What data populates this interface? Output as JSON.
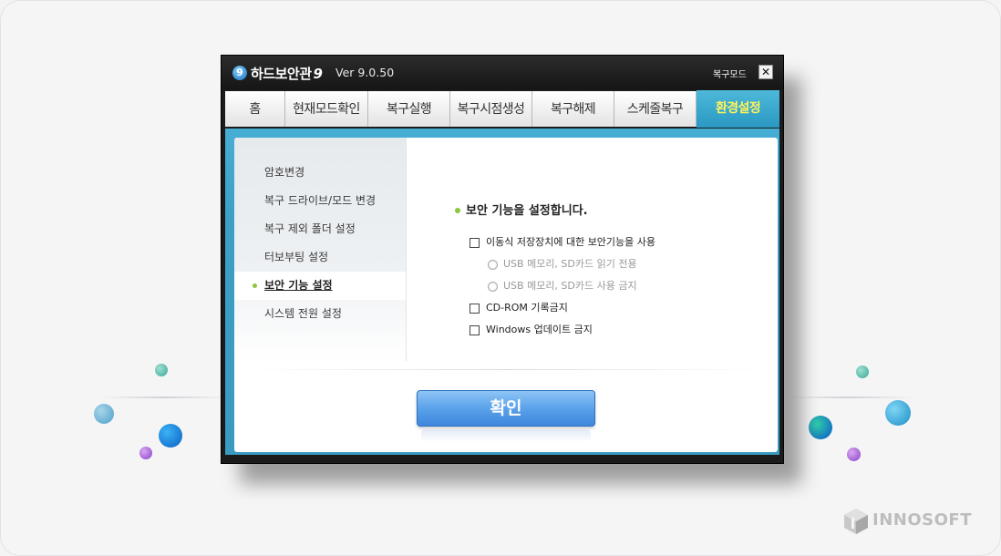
{
  "window": {
    "app_title": "하드보안관",
    "logo_glyph": "9",
    "title_number": "9",
    "version": "Ver 9.0.50",
    "recovery_mode_label": "복구모드",
    "close_label": "✕"
  },
  "tabs": [
    {
      "label": "홈",
      "active": false
    },
    {
      "label": "현재모드확인",
      "active": false
    },
    {
      "label": "복구실행",
      "active": false
    },
    {
      "label": "복구시점생성",
      "active": false
    },
    {
      "label": "복구해제",
      "active": false
    },
    {
      "label": "스케줄복구",
      "active": false
    },
    {
      "label": "환경설정",
      "active": true
    }
  ],
  "sidebar": {
    "items": [
      {
        "label": "암호변경",
        "active": false
      },
      {
        "label": "복구 드라이브/모드 변경",
        "active": false
      },
      {
        "label": "복구 제외 폴더 설정",
        "active": false
      },
      {
        "label": "터보부팅 설정",
        "active": false
      },
      {
        "label": "보안 기능 설정",
        "active": true
      },
      {
        "label": "시스템 전원 설정",
        "active": false
      }
    ]
  },
  "security": {
    "title": "보안 기능을 설정합니다.",
    "options": [
      {
        "type": "checkbox",
        "label": "이동식 저장장치에 대한 보안기능을 사용",
        "checked": false,
        "enabled": true
      },
      {
        "type": "radio",
        "label": "USB 메모리, SD카드 읽기 전용",
        "checked": false,
        "enabled": false
      },
      {
        "type": "radio",
        "label": "USB 메모리, SD카드 사용 금지",
        "checked": false,
        "enabled": false
      },
      {
        "type": "checkbox",
        "label": "CD-ROM 기록금지",
        "checked": false,
        "enabled": true
      },
      {
        "type": "checkbox",
        "label": "Windows 업데이트 금지",
        "checked": false,
        "enabled": true
      }
    ]
  },
  "confirm_label": "확인",
  "brand": {
    "name": "INNOSOFT"
  },
  "colors": {
    "accent_blue": "#3b9ac2",
    "active_tab_text": "#fff35a",
    "bullet_green": "#8dc63f",
    "button_blue": "#5aa2ea"
  }
}
